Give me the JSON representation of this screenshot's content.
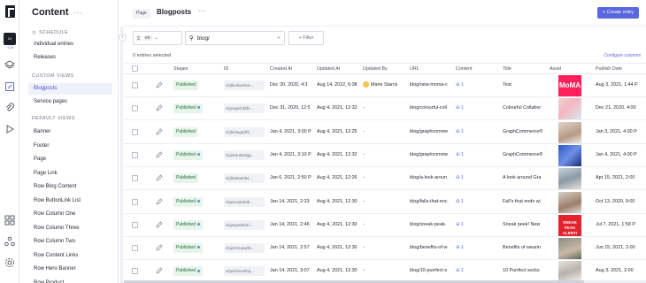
{
  "sidebar": {
    "title": "Content",
    "schedule_label": "SCHEDULE",
    "schedule_items": [
      "Individual entries",
      "Releases"
    ],
    "custom_views_label": "CUSTOM VIEWS",
    "custom_views": [
      "Blogposts",
      "Service pages"
    ],
    "default_views_label": "DEFAULT VIEWS",
    "default_views": [
      "Banner",
      "Footer",
      "Page",
      "Page Link",
      "Row Blog Content",
      "Row ButtonLink List",
      "Row Column One",
      "Row Column Three",
      "Row Column Two",
      "Row Content Links",
      "Row Hero Banner",
      "Row Product"
    ]
  },
  "rail": {
    "project_initials": "Gr",
    "project_sub": "~CM"
  },
  "header": {
    "crumb_page": "Page",
    "title": "Blogposts",
    "create_label": "+ Create entry"
  },
  "filters": {
    "locale": "en",
    "search_value": "blog/",
    "filter_label": "+ Filter"
  },
  "table_info": {
    "selected": "0 entries selected",
    "configure": "Configure columns"
  },
  "columns": [
    "Stages",
    "ID",
    "Created At",
    "Updated At",
    "Updated By",
    "URL",
    "Content",
    "Title",
    "Asset",
    "Publish Date"
  ],
  "rows": [
    {
      "stage": "Published",
      "dot": false,
      "id": "ckjbkvkwe0oz...",
      "created": "Dec 30, 2020, 4:3",
      "updated": "Aug 14, 2022, 6:38",
      "updated_by": "Marie Starck",
      "url": "blog/new-moma-c",
      "content": "1",
      "title": "Test",
      "asset": "MoMA",
      "publish": "Aug 3, 2021, 1:44 P"
    },
    {
      "stage": "Published",
      "dot": true,
      "id": "ckjcegsfc3kfn...",
      "created": "Dec 31, 2020, 12:5",
      "updated": "Aug 4, 2021, 12:32",
      "updated_by": "-",
      "url": "blog/colourful-coll",
      "content": "1",
      "title": "Colourful Collabor",
      "asset": "",
      "publish": "Dec 21, 2020, 4:00"
    },
    {
      "stage": "Published",
      "dot": false,
      "id": "ckjhizteg0dhl...",
      "created": "Jan 4, 2021, 3:00 P",
      "updated": "Aug 4, 2021, 12:25",
      "updated_by": "-",
      "url": "blog/graphcomme",
      "content": "1",
      "title": "GraphCommerce®",
      "asset": "",
      "publish": "Jan 3, 2021, 4:00 P"
    },
    {
      "stage": "Published",
      "dot": true,
      "id": "ckjin5ru823gg...",
      "created": "Jan 4, 2021, 3:10 P",
      "updated": "Aug 4, 2021, 12:32",
      "updated_by": "-",
      "url": "blog/graphcomme",
      "content": "1",
      "title": "GraphCommerce®",
      "asset": "",
      "publish": "Jan 4, 2021, 4:00 P"
    },
    {
      "stage": "Published",
      "dot": false,
      "id": "ckjhb6ew0ks...",
      "created": "Jan 6, 2021, 2:50 P",
      "updated": "Aug 4, 2021, 12:26",
      "updated_by": "-",
      "url": "blog/a-look-aroun",
      "content": "1",
      "title": "A look around Gra",
      "asset": "",
      "publish": "Apr 15, 2021, 2:00"
    },
    {
      "stage": "Published",
      "dot": true,
      "id": "ckjwvxaie00b...",
      "created": "Jan 14, 2021, 2:23",
      "updated": "Aug 4, 2021, 12:30",
      "updated_by": "-",
      "url": "blog/falls-that-enc",
      "content": "1",
      "title": "Fall's that ends wi",
      "asset": "",
      "publish": "Oct 13, 2020, 9:00"
    },
    {
      "stage": "Published",
      "dot": true,
      "id": "ckjwepark04l...",
      "created": "Jan 14, 2021, 2:46",
      "updated": "Aug 4, 2021, 12:30",
      "updated_by": "-",
      "url": "blog/sneak-peak-",
      "content": "1",
      "title": "Sneak peek! New",
      "asset": "SNEAK PEAK ALERT!",
      "publish": "Jul 7, 2021, 1:58 P"
    },
    {
      "stage": "Published",
      "dot": true,
      "id": "ckjws3mpw08...",
      "created": "Jan 14, 2021, 2:57",
      "updated": "Aug 4, 2021, 12:30",
      "updated_by": "-",
      "url": "blog/benefits-of-w",
      "content": "1",
      "title": "Benefits of wearin",
      "asset": "",
      "publish": "Jun 15, 2021, 2:00"
    },
    {
      "stage": "Published",
      "dot": true,
      "id": "ckjwxfzew0bq...",
      "created": "Jan 14, 2021, 3:07",
      "updated": "Aug 4, 2021, 12:30",
      "updated_by": "-",
      "url": "blog/10-purrfect-s",
      "content": "1",
      "title": "10 Purrfect socks",
      "asset": "",
      "publish": "Aug 3, 2021, 2:00"
    }
  ],
  "colors": {
    "accent": "#5a67e0",
    "published_bg": "#e6f4ea",
    "published_text": "#1f6f3a"
  }
}
